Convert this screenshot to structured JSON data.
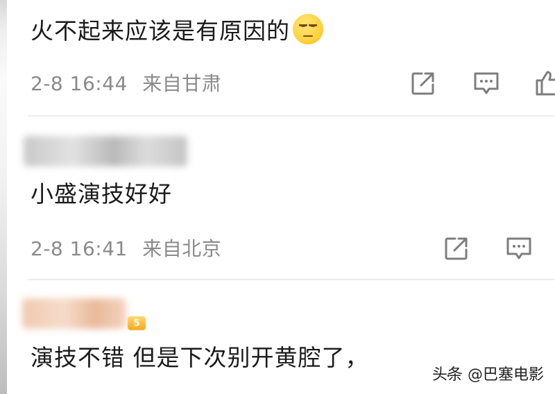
{
  "comments": [
    {
      "text": "火不起来应该是有原因的",
      "emoji": "unamused-face-emoji",
      "time": "2-8 16:44",
      "location": "来自甘肃",
      "actions": [
        "share-icon",
        "comment-icon",
        "like-icon"
      ]
    },
    {
      "username": "",
      "text": "小盛演技好好",
      "time": "2-8 16:41",
      "location": "来自北京",
      "actions": [
        "share-icon",
        "comment-icon"
      ]
    },
    {
      "username": "",
      "text": "演技不错 但是下次别开黄腔了，",
      "trailing": "..",
      "badge": "5"
    }
  ],
  "watermark": "头条 @巴塞电影",
  "colors": {
    "text": "#1a1a1a",
    "meta": "#8a8a8a",
    "divider": "#ececec",
    "icon": "#7d7d7d"
  }
}
